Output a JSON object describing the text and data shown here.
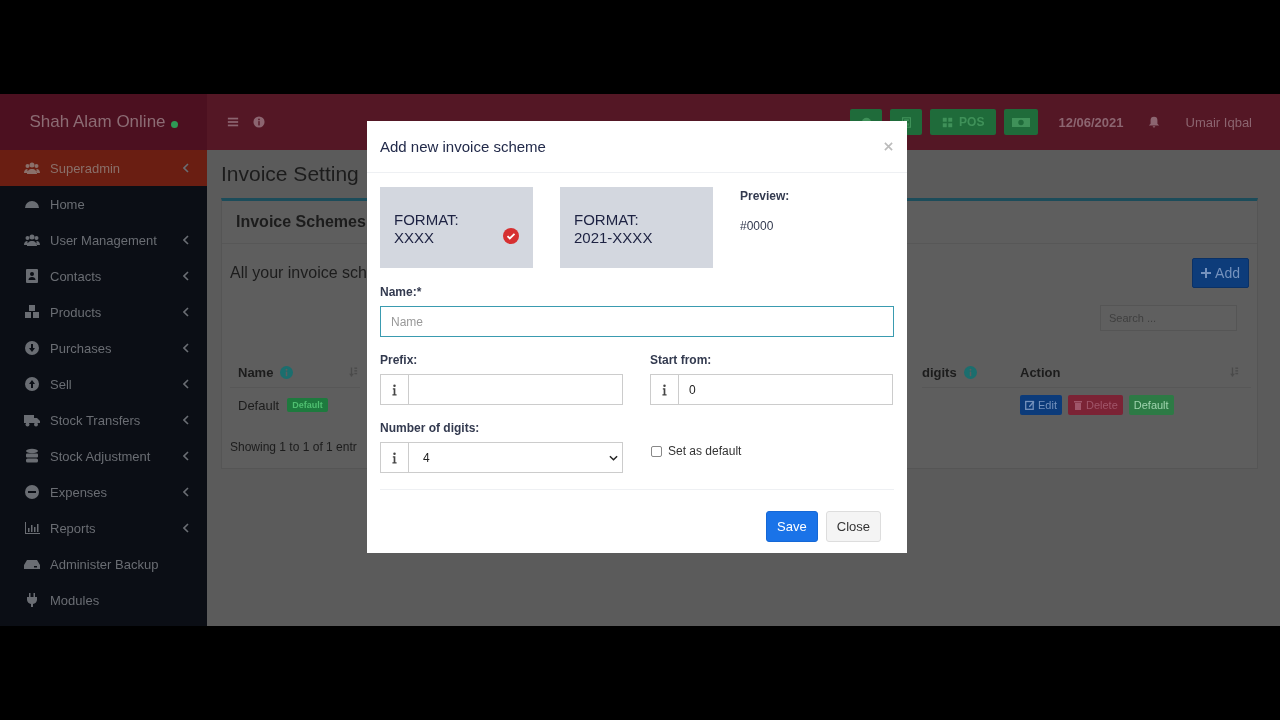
{
  "brand": {
    "name": "Shah Alam Online",
    "online": true
  },
  "header": {
    "pos_label": "POS",
    "date": "12/06/2021",
    "user": "Umair Iqbal"
  },
  "sidebar": {
    "items": [
      {
        "label": "Superadmin",
        "selected": true,
        "has_submenu": true
      },
      {
        "label": "Home",
        "selected": false,
        "has_submenu": false
      },
      {
        "label": "User Management",
        "selected": false,
        "has_submenu": true
      },
      {
        "label": "Contacts",
        "selected": false,
        "has_submenu": true
      },
      {
        "label": "Products",
        "selected": false,
        "has_submenu": true
      },
      {
        "label": "Purchases",
        "selected": false,
        "has_submenu": true
      },
      {
        "label": "Sell",
        "selected": false,
        "has_submenu": true
      },
      {
        "label": "Stock Transfers",
        "selected": false,
        "has_submenu": true
      },
      {
        "label": "Stock Adjustment",
        "selected": false,
        "has_submenu": true
      },
      {
        "label": "Expenses",
        "selected": false,
        "has_submenu": true
      },
      {
        "label": "Reports",
        "selected": false,
        "has_submenu": true
      },
      {
        "label": "Administer Backup",
        "selected": false,
        "has_submenu": false
      },
      {
        "label": "Modules",
        "selected": false,
        "has_submenu": false
      }
    ]
  },
  "page": {
    "title": "Invoice Setting",
    "card_title": "Invoice Schemes",
    "description": "All your invoice sch",
    "add_button": "Add",
    "search": {
      "placeholder": "Search ..."
    },
    "table": {
      "columns": [
        {
          "label": "Name",
          "info": true,
          "sortable": true
        },
        {
          "label": "digits",
          "info": true
        },
        {
          "label": "Action",
          "sortable": true
        }
      ],
      "rows": [
        {
          "name": "Default",
          "badge": "Default",
          "actions": [
            "Edit",
            "Delete",
            "Default"
          ]
        }
      ]
    },
    "footer": "Showing 1 to 1 of 1 entr"
  },
  "modal": {
    "title": "Add new invoice scheme",
    "formats": [
      {
        "label": "FORMAT:",
        "value": "XXXX",
        "selected": true
      },
      {
        "label": "FORMAT:",
        "value": "2021-XXXX",
        "selected": false
      }
    ],
    "preview_label": "Preview:",
    "preview_value": "#0000",
    "name": {
      "label": "Name:*",
      "placeholder": "Name",
      "focused": true
    },
    "prefix": {
      "label": "Prefix:"
    },
    "start_from": {
      "label": "Start from:",
      "value": "0"
    },
    "digits": {
      "label": "Number of digits:",
      "value": "4"
    },
    "set_default": {
      "label": "Set as default",
      "checked": false
    },
    "buttons": [
      "Save",
      "Close"
    ]
  }
}
